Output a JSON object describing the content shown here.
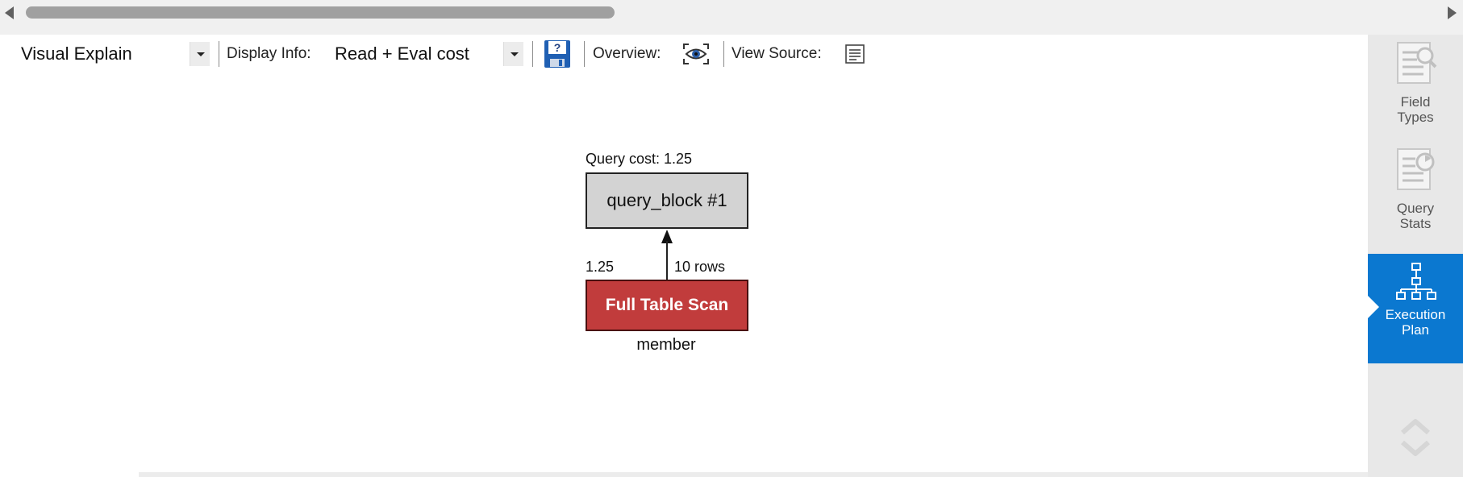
{
  "toolbar": {
    "view_mode": "Visual Explain",
    "display_info_label": "Display Info:",
    "display_info_value": "Read + Eval cost",
    "overview_label": "Overview:",
    "view_source_label": "View Source:"
  },
  "diagram": {
    "query_cost_label": "Query cost: 1.25",
    "query_block_label": "query_block #1",
    "edge_cost": "1.25",
    "edge_rows": "10 rows",
    "scan_label": "Full Table Scan",
    "table_name": "member",
    "colors": {
      "query_block": "#d3d3d3",
      "scan": "#c13c3c"
    }
  },
  "side_panel": {
    "items": [
      {
        "label_line1": "Field",
        "label_line2": "Types",
        "icon": "field-types-icon",
        "active": false
      },
      {
        "label_line1": "Query",
        "label_line2": "Stats",
        "icon": "query-stats-icon",
        "active": false
      },
      {
        "label_line1": "Execution",
        "label_line2": "Plan",
        "icon": "execution-plan-icon",
        "active": true
      }
    ],
    "accent_color": "#0b78d0"
  }
}
